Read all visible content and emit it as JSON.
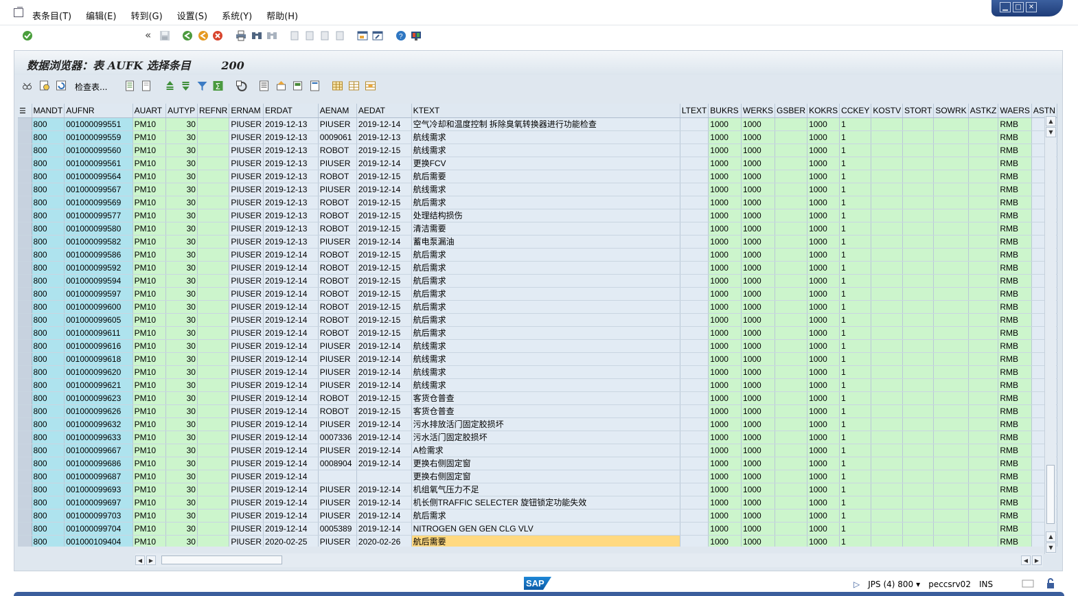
{
  "menubar": {
    "items": [
      "表条目(T)",
      "编辑(E)",
      "转到(G)",
      "设置(S)",
      "系统(Y)",
      "帮助(H)"
    ],
    "window_controls": [
      "minimize-icon",
      "maximize-icon",
      "close-icon"
    ]
  },
  "toolbar": {
    "command_field_value": "",
    "icons": [
      "enter-check-icon",
      "command-dropdown-icon",
      "collapse-icon",
      "save-icon",
      "back-icon",
      "exit-icon",
      "cancel-icon",
      "print-icon",
      "find-icon",
      "find-next-icon",
      "first-page-icon",
      "previous-page-icon",
      "next-page-icon",
      "last-page-icon",
      "create-session-icon",
      "shortcut-icon",
      "help-icon",
      "customize-layout-icon"
    ]
  },
  "app": {
    "title": "数据浏览器：表 AUFK 选择条目",
    "count": "200",
    "check_table_label": "检查表..."
  },
  "grid": {
    "columns": [
      "MANDT",
      "AUFNR",
      "AUART",
      "AUTYP",
      "REFNR",
      "ERNAM",
      "ERDAT",
      "AENAM",
      "AEDAT",
      "KTEXT",
      "LTEXT",
      "BUKRS",
      "WERKS",
      "GSBER",
      "KOKRS",
      "CCKEY",
      "KOSTV",
      "STORT",
      "SOWRK",
      "ASTKZ",
      "WAERS",
      "ASTN"
    ],
    "rows": [
      [
        "800",
        "001000099551",
        "PM10",
        "30",
        "",
        "PIUSER",
        "2019-12-13",
        "PIUSER",
        "2019-12-14",
        "空气冷却和温度控制 拆除臭氧转换器进行功能检查",
        "",
        "1000",
        "1000",
        "",
        "1000",
        "1",
        "",
        "",
        "",
        "",
        "RMB",
        ""
      ],
      [
        "800",
        "001000099559",
        "PM10",
        "30",
        "",
        "PIUSER",
        "2019-12-13",
        "0009061",
        "2019-12-13",
        "航线需求",
        "",
        "1000",
        "1000",
        "",
        "1000",
        "1",
        "",
        "",
        "",
        "",
        "RMB",
        ""
      ],
      [
        "800",
        "001000099560",
        "PM10",
        "30",
        "",
        "PIUSER",
        "2019-12-13",
        "ROBOT",
        "2019-12-15",
        "航线需求",
        "",
        "1000",
        "1000",
        "",
        "1000",
        "1",
        "",
        "",
        "",
        "",
        "RMB",
        ""
      ],
      [
        "800",
        "001000099561",
        "PM10",
        "30",
        "",
        "PIUSER",
        "2019-12-13",
        "PIUSER",
        "2019-12-14",
        "更换FCV",
        "",
        "1000",
        "1000",
        "",
        "1000",
        "1",
        "",
        "",
        "",
        "",
        "RMB",
        ""
      ],
      [
        "800",
        "001000099564",
        "PM10",
        "30",
        "",
        "PIUSER",
        "2019-12-13",
        "ROBOT",
        "2019-12-15",
        "航后需要",
        "",
        "1000",
        "1000",
        "",
        "1000",
        "1",
        "",
        "",
        "",
        "",
        "RMB",
        ""
      ],
      [
        "800",
        "001000099567",
        "PM10",
        "30",
        "",
        "PIUSER",
        "2019-12-13",
        "PIUSER",
        "2019-12-14",
        "航线需求",
        "",
        "1000",
        "1000",
        "",
        "1000",
        "1",
        "",
        "",
        "",
        "",
        "RMB",
        ""
      ],
      [
        "800",
        "001000099569",
        "PM10",
        "30",
        "",
        "PIUSER",
        "2019-12-13",
        "ROBOT",
        "2019-12-15",
        "航后需求",
        "",
        "1000",
        "1000",
        "",
        "1000",
        "1",
        "",
        "",
        "",
        "",
        "RMB",
        ""
      ],
      [
        "800",
        "001000099577",
        "PM10",
        "30",
        "",
        "PIUSER",
        "2019-12-13",
        "ROBOT",
        "2019-12-15",
        "处理结构损伤",
        "",
        "1000",
        "1000",
        "",
        "1000",
        "1",
        "",
        "",
        "",
        "",
        "RMB",
        ""
      ],
      [
        "800",
        "001000099580",
        "PM10",
        "30",
        "",
        "PIUSER",
        "2019-12-13",
        "ROBOT",
        "2019-12-15",
        "清洁需要",
        "",
        "1000",
        "1000",
        "",
        "1000",
        "1",
        "",
        "",
        "",
        "",
        "RMB",
        ""
      ],
      [
        "800",
        "001000099582",
        "PM10",
        "30",
        "",
        "PIUSER",
        "2019-12-13",
        "PIUSER",
        "2019-12-14",
        "蓄电泵漏油",
        "",
        "1000",
        "1000",
        "",
        "1000",
        "1",
        "",
        "",
        "",
        "",
        "RMB",
        ""
      ],
      [
        "800",
        "001000099586",
        "PM10",
        "30",
        "",
        "PIUSER",
        "2019-12-14",
        "ROBOT",
        "2019-12-15",
        "航后需求",
        "",
        "1000",
        "1000",
        "",
        "1000",
        "1",
        "",
        "",
        "",
        "",
        "RMB",
        ""
      ],
      [
        "800",
        "001000099592",
        "PM10",
        "30",
        "",
        "PIUSER",
        "2019-12-14",
        "ROBOT",
        "2019-12-15",
        "航后需求",
        "",
        "1000",
        "1000",
        "",
        "1000",
        "1",
        "",
        "",
        "",
        "",
        "RMB",
        ""
      ],
      [
        "800",
        "001000099594",
        "PM10",
        "30",
        "",
        "PIUSER",
        "2019-12-14",
        "ROBOT",
        "2019-12-15",
        "航后需求",
        "",
        "1000",
        "1000",
        "",
        "1000",
        "1",
        "",
        "",
        "",
        "",
        "RMB",
        ""
      ],
      [
        "800",
        "001000099597",
        "PM10",
        "30",
        "",
        "PIUSER",
        "2019-12-14",
        "ROBOT",
        "2019-12-15",
        "航后需求",
        "",
        "1000",
        "1000",
        "",
        "1000",
        "1",
        "",
        "",
        "",
        "",
        "RMB",
        ""
      ],
      [
        "800",
        "001000099600",
        "PM10",
        "30",
        "",
        "PIUSER",
        "2019-12-14",
        "ROBOT",
        "2019-12-15",
        "航后需求",
        "",
        "1000",
        "1000",
        "",
        "1000",
        "1",
        "",
        "",
        "",
        "",
        "RMB",
        ""
      ],
      [
        "800",
        "001000099605",
        "PM10",
        "30",
        "",
        "PIUSER",
        "2019-12-14",
        "ROBOT",
        "2019-12-15",
        "航后需求",
        "",
        "1000",
        "1000",
        "",
        "1000",
        "1",
        "",
        "",
        "",
        "",
        "RMB",
        ""
      ],
      [
        "800",
        "001000099611",
        "PM10",
        "30",
        "",
        "PIUSER",
        "2019-12-14",
        "ROBOT",
        "2019-12-15",
        "航后需求",
        "",
        "1000",
        "1000",
        "",
        "1000",
        "1",
        "",
        "",
        "",
        "",
        "RMB",
        ""
      ],
      [
        "800",
        "001000099616",
        "PM10",
        "30",
        "",
        "PIUSER",
        "2019-12-14",
        "PIUSER",
        "2019-12-14",
        "航线需求",
        "",
        "1000",
        "1000",
        "",
        "1000",
        "1",
        "",
        "",
        "",
        "",
        "RMB",
        ""
      ],
      [
        "800",
        "001000099618",
        "PM10",
        "30",
        "",
        "PIUSER",
        "2019-12-14",
        "PIUSER",
        "2019-12-14",
        "航线需求",
        "",
        "1000",
        "1000",
        "",
        "1000",
        "1",
        "",
        "",
        "",
        "",
        "RMB",
        ""
      ],
      [
        "800",
        "001000099620",
        "PM10",
        "30",
        "",
        "PIUSER",
        "2019-12-14",
        "PIUSER",
        "2019-12-14",
        "航线需求",
        "",
        "1000",
        "1000",
        "",
        "1000",
        "1",
        "",
        "",
        "",
        "",
        "RMB",
        ""
      ],
      [
        "800",
        "001000099621",
        "PM10",
        "30",
        "",
        "PIUSER",
        "2019-12-14",
        "PIUSER",
        "2019-12-14",
        "航线需求",
        "",
        "1000",
        "1000",
        "",
        "1000",
        "1",
        "",
        "",
        "",
        "",
        "RMB",
        ""
      ],
      [
        "800",
        "001000099623",
        "PM10",
        "30",
        "",
        "PIUSER",
        "2019-12-14",
        "ROBOT",
        "2019-12-15",
        "客货仓普查",
        "",
        "1000",
        "1000",
        "",
        "1000",
        "1",
        "",
        "",
        "",
        "",
        "RMB",
        ""
      ],
      [
        "800",
        "001000099626",
        "PM10",
        "30",
        "",
        "PIUSER",
        "2019-12-14",
        "ROBOT",
        "2019-12-15",
        "客货仓普查",
        "",
        "1000",
        "1000",
        "",
        "1000",
        "1",
        "",
        "",
        "",
        "",
        "RMB",
        ""
      ],
      [
        "800",
        "001000099632",
        "PM10",
        "30",
        "",
        "PIUSER",
        "2019-12-14",
        "PIUSER",
        "2019-12-14",
        "污水排放活门固定胶损坏",
        "",
        "1000",
        "1000",
        "",
        "1000",
        "1",
        "",
        "",
        "",
        "",
        "RMB",
        ""
      ],
      [
        "800",
        "001000099633",
        "PM10",
        "30",
        "",
        "PIUSER",
        "2019-12-14",
        "0007336",
        "2019-12-14",
        "污水活门固定胶损坏",
        "",
        "1000",
        "1000",
        "",
        "1000",
        "1",
        "",
        "",
        "",
        "",
        "RMB",
        ""
      ],
      [
        "800",
        "001000099667",
        "PM10",
        "30",
        "",
        "PIUSER",
        "2019-12-14",
        "PIUSER",
        "2019-12-14",
        "A检需求",
        "",
        "1000",
        "1000",
        "",
        "1000",
        "1",
        "",
        "",
        "",
        "",
        "RMB",
        ""
      ],
      [
        "800",
        "001000099686",
        "PM10",
        "30",
        "",
        "PIUSER",
        "2019-12-14",
        "0008904",
        "2019-12-14",
        "更换右侧固定窗",
        "",
        "1000",
        "1000",
        "",
        "1000",
        "1",
        "",
        "",
        "",
        "",
        "RMB",
        ""
      ],
      [
        "800",
        "001000099687",
        "PM10",
        "30",
        "",
        "PIUSER",
        "2019-12-14",
        "",
        "",
        "更换右侧固定窗",
        "",
        "1000",
        "1000",
        "",
        "1000",
        "1",
        "",
        "",
        "",
        "",
        "RMB",
        ""
      ],
      [
        "800",
        "001000099693",
        "PM10",
        "30",
        "",
        "PIUSER",
        "2019-12-14",
        "PIUSER",
        "2019-12-14",
        "机组氧气压力不足",
        "",
        "1000",
        "1000",
        "",
        "1000",
        "1",
        "",
        "",
        "",
        "",
        "RMB",
        ""
      ],
      [
        "800",
        "001000099697",
        "PM10",
        "30",
        "",
        "PIUSER",
        "2019-12-14",
        "PIUSER",
        "2019-12-14",
        "机长侧TRAFFIC SELECTER 旋钮锁定功能失效",
        "",
        "1000",
        "1000",
        "",
        "1000",
        "1",
        "",
        "",
        "",
        "",
        "RMB",
        ""
      ],
      [
        "800",
        "001000099703",
        "PM10",
        "30",
        "",
        "PIUSER",
        "2019-12-14",
        "PIUSER",
        "2019-12-14",
        "航后需求",
        "",
        "1000",
        "1000",
        "",
        "1000",
        "1",
        "",
        "",
        "",
        "",
        "RMB",
        ""
      ],
      [
        "800",
        "001000099704",
        "PM10",
        "30",
        "",
        "PIUSER",
        "2019-12-14",
        "0005389",
        "2019-12-14",
        "NITROGEN GEN GEN CLG VLV",
        "",
        "1000",
        "1000",
        "",
        "1000",
        "1",
        "",
        "",
        "",
        "",
        "RMB",
        ""
      ],
      [
        "800",
        "001000109404",
        "PM10",
        "30",
        "",
        "PIUSER",
        "2020-02-25",
        "PIUSER",
        "2020-02-26",
        "航后需要",
        "",
        "1000",
        "1000",
        "",
        "1000",
        "1",
        "",
        "",
        "",
        "",
        "RMB",
        ""
      ]
    ],
    "highlight": {
      "row": 32,
      "column": "KTEXT"
    }
  },
  "status": {
    "logo": "SAP",
    "system": "JPS (4) 800",
    "server": "peccsrv02",
    "mode": "INS"
  }
}
